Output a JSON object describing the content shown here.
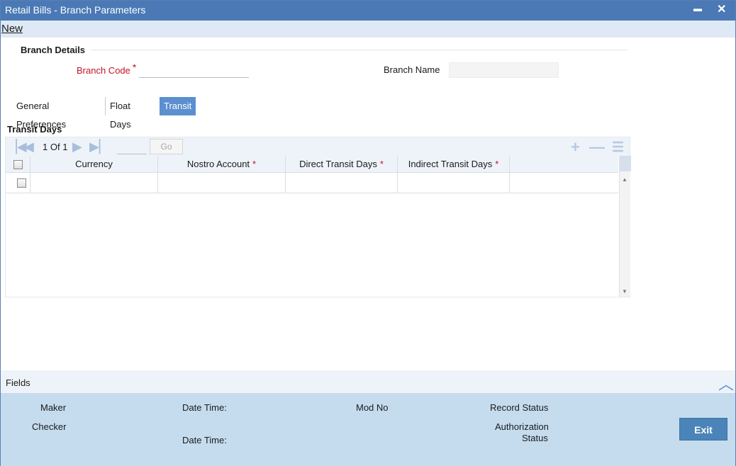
{
  "window": {
    "title": "Retail Bills - Branch Parameters",
    "minimize_glyph": "▬",
    "close_glyph": "✕"
  },
  "menu": {
    "new_label": "New"
  },
  "branch_details": {
    "title": "Branch Details",
    "branch_code_label": "Branch Code",
    "branch_code_value": "",
    "branch_name_label": "Branch Name",
    "branch_name_value": ""
  },
  "tabs": [
    {
      "label": "General Preferences",
      "active": false
    },
    {
      "label": "Float Days",
      "active": false
    },
    {
      "label": "Transit Days",
      "active": true
    }
  ],
  "grid": {
    "title": "Transit Days",
    "pager": {
      "current": "1",
      "of_label": "Of",
      "total": "1",
      "page_input": "",
      "go_label": "Go"
    },
    "columns": [
      {
        "label": "Currency",
        "required": false
      },
      {
        "label": "Nostro Account",
        "required": true
      },
      {
        "label": "Direct Transit Days",
        "required": true
      },
      {
        "label": "Indirect Transit Days",
        "required": true
      }
    ],
    "required_marker": "*",
    "rows": [
      {
        "currency": "",
        "nostro_account": "",
        "direct_transit_days": "",
        "indirect_transit_days": ""
      }
    ]
  },
  "fields_bar": {
    "label": "Fields"
  },
  "audit": {
    "maker_label": "Maker",
    "checker_label": "Checker",
    "date_time_label": "Date Time:",
    "date_time_label_2": "Date Time:",
    "mod_no_label": "Mod No",
    "record_status_label": "Record Status",
    "authorization_label": "Authorization",
    "status_label": "Status",
    "exit_label": "Exit"
  },
  "colors": {
    "titlebar": "#4a79b6",
    "active_tab": "#5b8fd0",
    "required_red": "#c0142a",
    "footer": "#c5dcef",
    "exit_button": "#4a84b8"
  },
  "icons": {
    "pager_first": "first-page-icon",
    "pager_prev": "previous-page-icon",
    "pager_next": "next-page-icon",
    "pager_last": "last-page-icon",
    "add_row": "add-row-icon",
    "delete_row": "delete-row-icon",
    "single_view": "single-record-view-icon",
    "collapse": "chevron-up-icon"
  }
}
